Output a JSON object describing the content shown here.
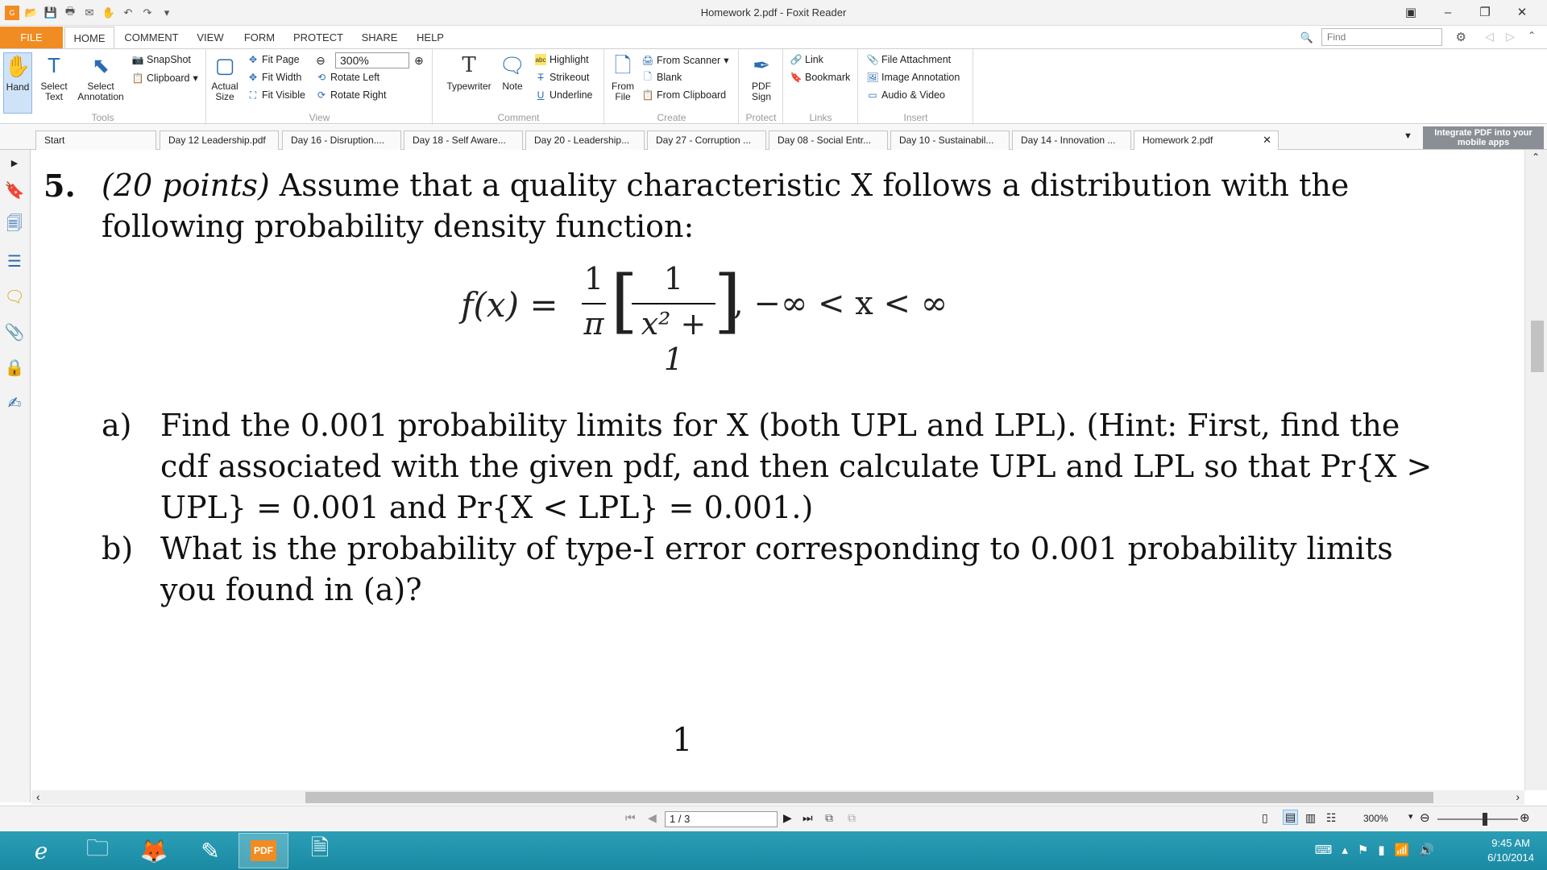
{
  "window": {
    "title": "Homework 2.pdf - Foxit Reader"
  },
  "menu": {
    "tabs": [
      "FILE",
      "HOME",
      "COMMENT",
      "VIEW",
      "FORM",
      "PROTECT",
      "SHARE",
      "HELP"
    ],
    "find_placeholder": "Find"
  },
  "ribbon": {
    "tools": {
      "label": "Tools",
      "hand": "Hand",
      "select_text": "Select Text",
      "select_annotation": "Select Annotation",
      "snapshot": "SnapShot",
      "clipboard": "Clipboard"
    },
    "view": {
      "label": "View",
      "actual_size": "Actual Size",
      "fit_page": "Fit Page",
      "fit_width": "Fit Width",
      "fit_visible": "Fit Visible",
      "zoom": "300%",
      "rotate_left": "Rotate Left",
      "rotate_right": "Rotate Right"
    },
    "comment": {
      "label": "Comment",
      "typewriter": "Typewriter",
      "note": "Note",
      "highlight": "Highlight",
      "strikeout": "Strikeout",
      "underline": "Underline"
    },
    "create": {
      "label": "Create",
      "from_file": "From File",
      "from_scanner": "From Scanner",
      "blank": "Blank",
      "from_clipboard": "From Clipboard"
    },
    "protect": {
      "label": "Protect",
      "pdf_sign": "PDF Sign"
    },
    "links": {
      "label": "Links",
      "link": "Link",
      "bookmark": "Bookmark"
    },
    "insert": {
      "label": "Insert",
      "file_attachment": "File Attachment",
      "image_annotation": "Image Annotation",
      "audio_video": "Audio & Video"
    }
  },
  "doc_tabs": [
    "Start",
    "Day 12 Leadership.pdf",
    "Day 16 - Disruption....",
    "Day 18 - Self Aware...",
    "Day 20 - Leadership...",
    "Day 27 - Corruption ...",
    "Day 08 - Social Entr...",
    "Day 10 - Sustainabil...",
    "Day 14 - Innovation ...",
    "Homework 2.pdf"
  ],
  "integrate": "Integrate PDF into your mobile apps",
  "document": {
    "q_number": "5.",
    "q_points": "(20 points)",
    "q_line1_rest": " Assume that a quality characteristic X follows a distribution with the",
    "q_line2": "following probability density function:",
    "formula": {
      "lhs": "f(x) =",
      "num1": "1",
      "den1": "π",
      "num2": "1",
      "den2": "x² + 1",
      "range": ", −∞ < x < ∞"
    },
    "a_label": "a)",
    "a_line1": "Find the 0.001 probability limits for X (both UPL and LPL).  (Hint: First, find the",
    "a_line2": "cdf associated with the given pdf, and then calculate UPL and LPL so that Pr{X >",
    "a_line3": "UPL} = 0.001 and Pr{X < LPL} = 0.001.)",
    "b_label": "b)",
    "b_line1": "What is the probability of type-I error corresponding to 0.001 probability limits",
    "b_line2": "you found in (a)?",
    "page_number": "1"
  },
  "status": {
    "page": "1 / 3",
    "zoom": "300%"
  },
  "taskbar": {
    "time": "9:45 AM",
    "date": "6/10/2014"
  }
}
